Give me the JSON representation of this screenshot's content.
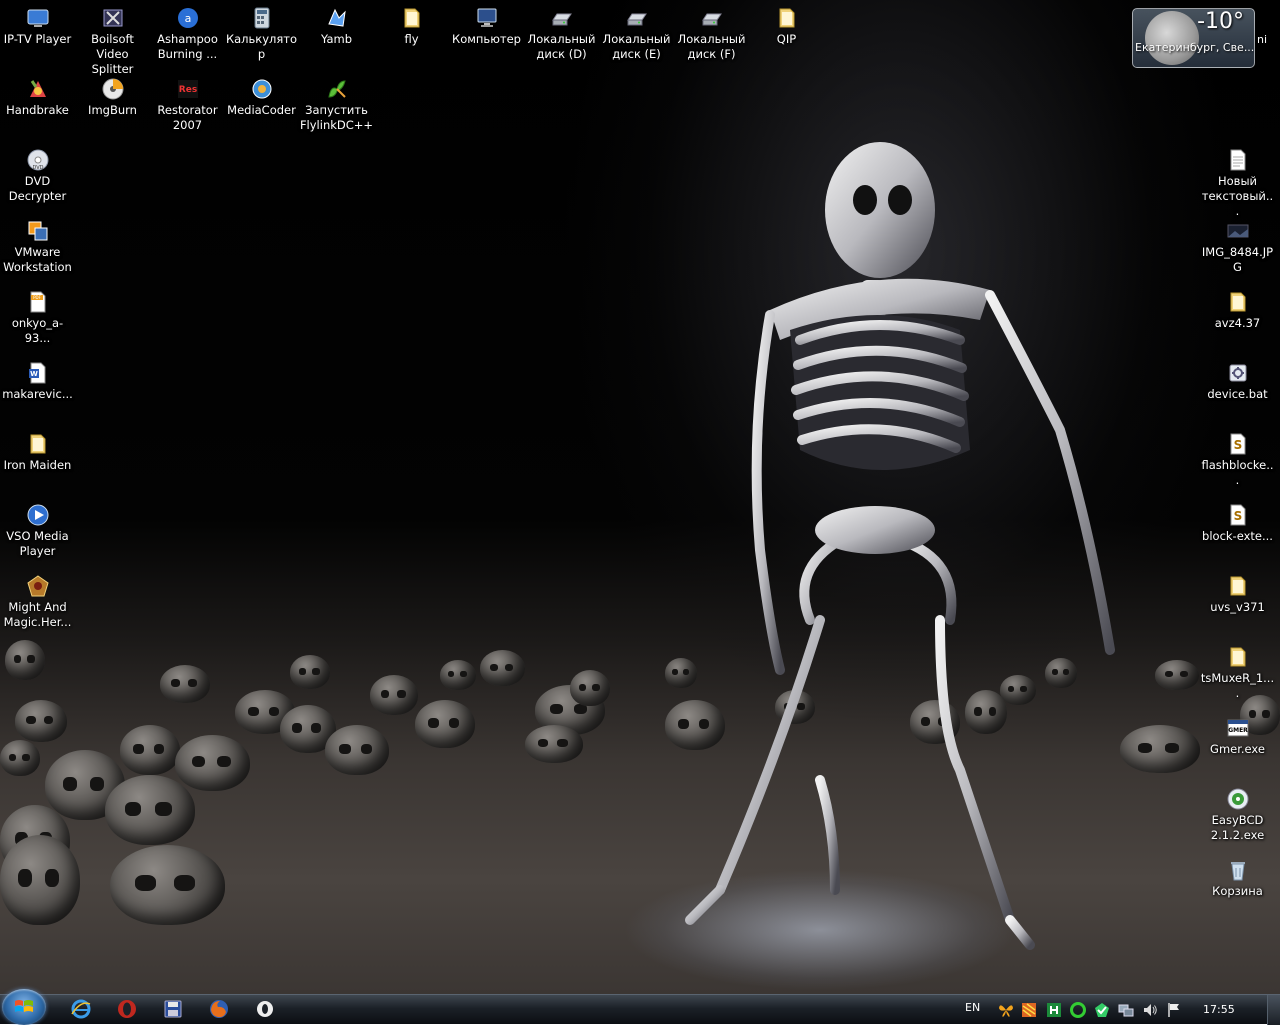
{
  "desktop": {
    "icons": [
      {
        "label": "IP-TV Player",
        "icon": "tv-player-icon"
      },
      {
        "label": "Boilsoft\nVideo Splitter",
        "icon": "video-splitter-icon"
      },
      {
        "label": "Ashampoo\nBurning ...",
        "icon": "burning-disc-icon"
      },
      {
        "label": "Калькулятор",
        "icon": "calculator-icon"
      },
      {
        "label": "Yamb",
        "icon": "yamb-icon"
      },
      {
        "label": "fly",
        "icon": "folder-icon"
      },
      {
        "label": "Компьютер",
        "icon": "computer-icon"
      },
      {
        "label": "Локальный\nдиск (D)",
        "icon": "drive-icon"
      },
      {
        "label": "Локальный\nдиск (E)",
        "icon": "drive-icon"
      },
      {
        "label": "Локальный\nдиск (F)",
        "icon": "drive-icon"
      },
      {
        "label": "QIP",
        "icon": "folder-icon"
      },
      {
        "label": "Handbrake",
        "icon": "handbrake-icon"
      },
      {
        "label": "ImgBurn",
        "icon": "imgburn-icon"
      },
      {
        "label": "Restorator\n2007",
        "icon": "restorator-icon"
      },
      {
        "label": "MediaCoder",
        "icon": "mediacoder-icon"
      },
      {
        "label": "Запустить\nFlylinkDC++",
        "icon": "flylink-icon"
      },
      {
        "label": "DVD\nDecrypter",
        "icon": "dvd-icon"
      },
      {
        "label": "VMware\nWorkstation",
        "icon": "vmware-icon"
      },
      {
        "label": "onkyo_a-93...",
        "icon": "pdf-document-icon"
      },
      {
        "label": "makarevic...",
        "icon": "word-document-icon"
      },
      {
        "label": "Iron Maiden",
        "icon": "folder-icon"
      },
      {
        "label": "VSO Media\nPlayer",
        "icon": "media-player-icon"
      },
      {
        "label": "Might And\nMagic.Her...",
        "icon": "game-icon"
      },
      {
        "label": "Новый\nтекстовый...",
        "icon": "text-document-icon"
      },
      {
        "label": "IMG_8484.JP\nG",
        "icon": "image-file-icon"
      },
      {
        "label": "avz4.37",
        "icon": "folder-icon"
      },
      {
        "label": "device.bat",
        "icon": "batch-file-icon"
      },
      {
        "label": "flashblocke...",
        "icon": "script-file-icon"
      },
      {
        "label": "block-exte...",
        "icon": "script-file-icon"
      },
      {
        "label": "uvs_v371",
        "icon": "folder-icon"
      },
      {
        "label": "tsMuxeR_1....",
        "icon": "folder-icon"
      },
      {
        "label": "Gmer.exe",
        "icon": "gmer-icon"
      },
      {
        "label": "EasyBCD\n2.1.2.exe",
        "icon": "easybcd-icon"
      },
      {
        "label": "Корзина",
        "icon": "recycle-bin-icon"
      }
    ]
  },
  "weather": {
    "temperature": "-10°",
    "city": "Екатеринбург, Све...",
    "edge_text": "ni"
  },
  "taskbar": {
    "quick_launch": [
      "internet-explorer-icon",
      "opera-icon",
      "floppy-save-icon",
      "firefox-icon",
      "media-app-icon"
    ],
    "language": "EN",
    "tray_icons": [
      "butterfly-icon",
      "antivirus-icon",
      "network-monitor-icon",
      "green-circle-icon",
      "security-check-icon",
      "network-icon",
      "volume-icon",
      "flag-icon"
    ],
    "clock": "17:55"
  },
  "colors": {
    "taskbar_top": "#3f4750",
    "taskbar_bottom": "#0b0e12",
    "label_text": "#ffffff"
  }
}
